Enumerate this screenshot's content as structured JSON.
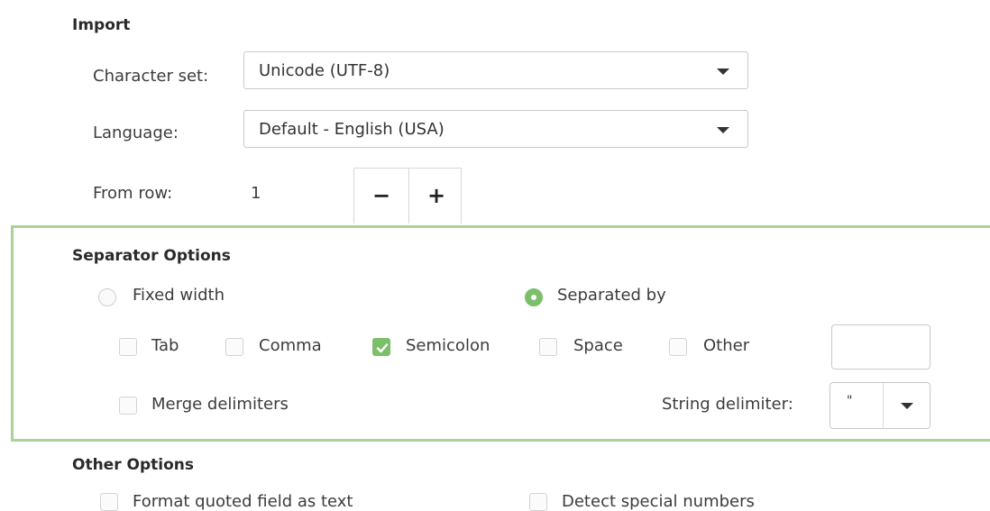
{
  "import": {
    "heading": "Import",
    "character_set": {
      "label": "Character set:",
      "value": "Unicode (UTF-8)"
    },
    "language": {
      "label": "Language:",
      "value": "Default - English (USA)"
    },
    "from_row": {
      "label": "From row:",
      "value": "1",
      "minus": "−",
      "plus": "+"
    }
  },
  "separator": {
    "heading": "Separator Options",
    "fixed_width": {
      "label": "Fixed width",
      "selected": false
    },
    "separated_by": {
      "label": "Separated by",
      "selected": true
    },
    "tab": {
      "label": "Tab",
      "checked": false
    },
    "comma": {
      "label": "Comma",
      "checked": false
    },
    "semicolon": {
      "label": "Semicolon",
      "checked": true
    },
    "space": {
      "label": "Space",
      "checked": false
    },
    "other": {
      "label": "Other",
      "checked": false,
      "value": ""
    },
    "merge": {
      "label": "Merge delimiters",
      "checked": false
    },
    "string_delimiter": {
      "label": "String delimiter:",
      "value": "\""
    }
  },
  "other_options": {
    "heading": "Other Options",
    "format_quoted": {
      "label": "Format quoted field as text",
      "checked": false
    },
    "detect_special": {
      "label": "Detect special numbers",
      "checked": false
    }
  },
  "colors": {
    "accent": "#7cbf6a",
    "highlight_border": "#a9d19a"
  }
}
